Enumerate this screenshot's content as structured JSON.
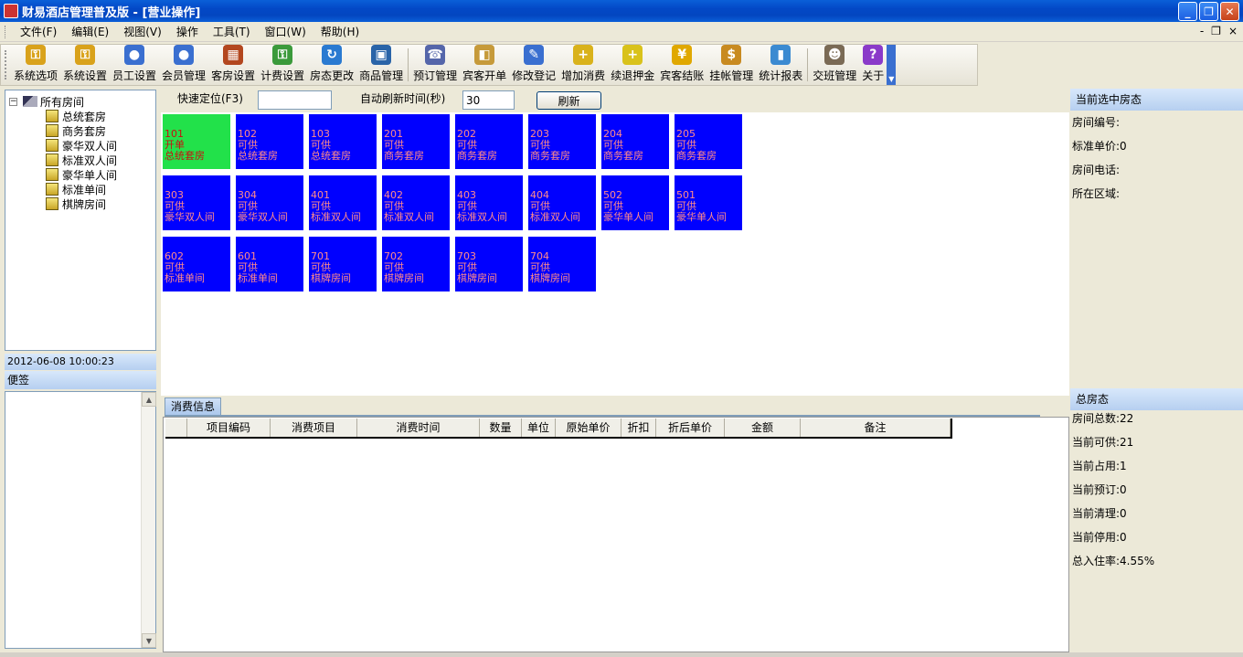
{
  "window": {
    "title": "财易酒店管理普及版 - [营业操作]",
    "minimize": "_",
    "restore": "❐",
    "close": "✕"
  },
  "menu": {
    "items": [
      "文件(F)",
      "编辑(E)",
      "视图(V)",
      "操作",
      "工具(T)",
      "窗口(W)",
      "帮助(H)"
    ],
    "mdi_min": "-",
    "mdi_restore": "❐",
    "mdi_close": "×"
  },
  "toolbar": {
    "buttons": [
      {
        "label": "系统选项",
        "icon": "key-icon",
        "color": "#d9a21b"
      },
      {
        "label": "系统设置",
        "icon": "key-icon",
        "color": "#d9a21b"
      },
      {
        "label": "员工设置",
        "icon": "person-icon",
        "color": "#3a6fd0"
      },
      {
        "label": "会员管理",
        "icon": "person-icon",
        "color": "#3a6fd0"
      },
      {
        "label": "客房设置",
        "icon": "building-icon",
        "color": "#b3471f"
      },
      {
        "label": "计费设置",
        "icon": "key-icon",
        "color": "#3b9a3b"
      },
      {
        "label": "房态更改",
        "icon": "refresh-icon",
        "color": "#2a7ad1"
      },
      {
        "label": "商品管理",
        "icon": "box-icon",
        "color": "#2a64a8"
      },
      {
        "label": "预订管理",
        "icon": "phone-icon",
        "color": "#5566aa"
      },
      {
        "label": "宾客开单",
        "icon": "package-icon",
        "color": "#c69a3a"
      },
      {
        "label": "修改登记",
        "icon": "person-edit-icon",
        "color": "#3a6fd0"
      },
      {
        "label": "增加消费",
        "icon": "add-folder-icon",
        "color": "#d9b21b"
      },
      {
        "label": "续退押金",
        "icon": "add-doc-icon",
        "color": "#d9c21b"
      },
      {
        "label": "宾客结账",
        "icon": "yen-coin-icon",
        "color": "#e0a800"
      },
      {
        "label": "挂帐管理",
        "icon": "money-bag-icon",
        "color": "#c88a20"
      },
      {
        "label": "统计报表",
        "icon": "bar-chart-icon",
        "color": "#3b8ad1"
      },
      {
        "label": "交班管理",
        "icon": "users-icon",
        "color": "#7a6a55"
      },
      {
        "label": "关于",
        "icon": "question-icon",
        "color": "#8a3ac9"
      }
    ]
  },
  "tree": {
    "root": "所有房间",
    "items": [
      "总统套房",
      "商务套房",
      "豪华双人间",
      "标准双人间",
      "豪华单人间",
      "标准单间",
      "棋牌房间"
    ]
  },
  "datetime": "2012-06-08 10:00:23",
  "memo": {
    "title": "便签"
  },
  "quick": {
    "locate_label": "快速定位(F3)",
    "locate_value": "",
    "refresh_label": "自动刷新时间(秒)",
    "refresh_value": "30",
    "refresh_button": "刷新"
  },
  "rooms": [
    {
      "no": "101",
      "status": "开单",
      "type": "总统套房",
      "occupied": true
    },
    {
      "no": "102",
      "status": "可供",
      "type": "总统套房"
    },
    {
      "no": "103",
      "status": "可供",
      "type": "总统套房"
    },
    {
      "no": "201",
      "status": "可供",
      "type": "商务套房"
    },
    {
      "no": "202",
      "status": "可供",
      "type": "商务套房"
    },
    {
      "no": "203",
      "status": "可供",
      "type": "商务套房"
    },
    {
      "no": "204",
      "status": "可供",
      "type": "商务套房"
    },
    {
      "no": "205",
      "status": "可供",
      "type": "商务套房"
    },
    {
      "no": "303",
      "status": "可供",
      "type": "豪华双人间"
    },
    {
      "no": "304",
      "status": "可供",
      "type": "豪华双人间"
    },
    {
      "no": "401",
      "status": "可供",
      "type": "标准双人间"
    },
    {
      "no": "402",
      "status": "可供",
      "type": "标准双人间"
    },
    {
      "no": "403",
      "status": "可供",
      "type": "标准双人间"
    },
    {
      "no": "404",
      "status": "可供",
      "type": "标准双人间"
    },
    {
      "no": "502",
      "status": "可供",
      "type": "豪华单人间"
    },
    {
      "no": "501",
      "status": "可供",
      "type": "豪华单人间"
    },
    {
      "no": "602",
      "status": "可供",
      "type": "标准单间"
    },
    {
      "no": "601",
      "status": "可供",
      "type": "标准单间"
    },
    {
      "no": "701",
      "status": "可供",
      "type": "棋牌房间"
    },
    {
      "no": "702",
      "status": "可供",
      "type": "棋牌房间"
    },
    {
      "no": "703",
      "status": "可供",
      "type": "棋牌房间"
    },
    {
      "no": "704",
      "status": "可供",
      "type": "棋牌房间"
    }
  ],
  "consume": {
    "tab": "消费信息",
    "columns": [
      "",
      "项目编码",
      "消费项目",
      "消费时间",
      "数量",
      "单位",
      "原始单价",
      "折扣",
      "折后单价",
      "金额",
      "备注"
    ]
  },
  "current_room": {
    "title": "当前选中房态",
    "fields": [
      "房间编号:",
      "标准单价:0",
      "房间电话:",
      "所在区域:"
    ]
  },
  "summary": {
    "title": "总房态",
    "fields": [
      "房间总数:22",
      "当前可供:21",
      "当前占用:1",
      "当前预订:0",
      "当前清理:0",
      "当前停用:0",
      "总入住率:4.55%"
    ]
  },
  "colors": {
    "available_room": "#0000ff",
    "occupied_room": "#22e14a",
    "available_text": "#ff8a8a",
    "occupied_text": "#c81010"
  }
}
